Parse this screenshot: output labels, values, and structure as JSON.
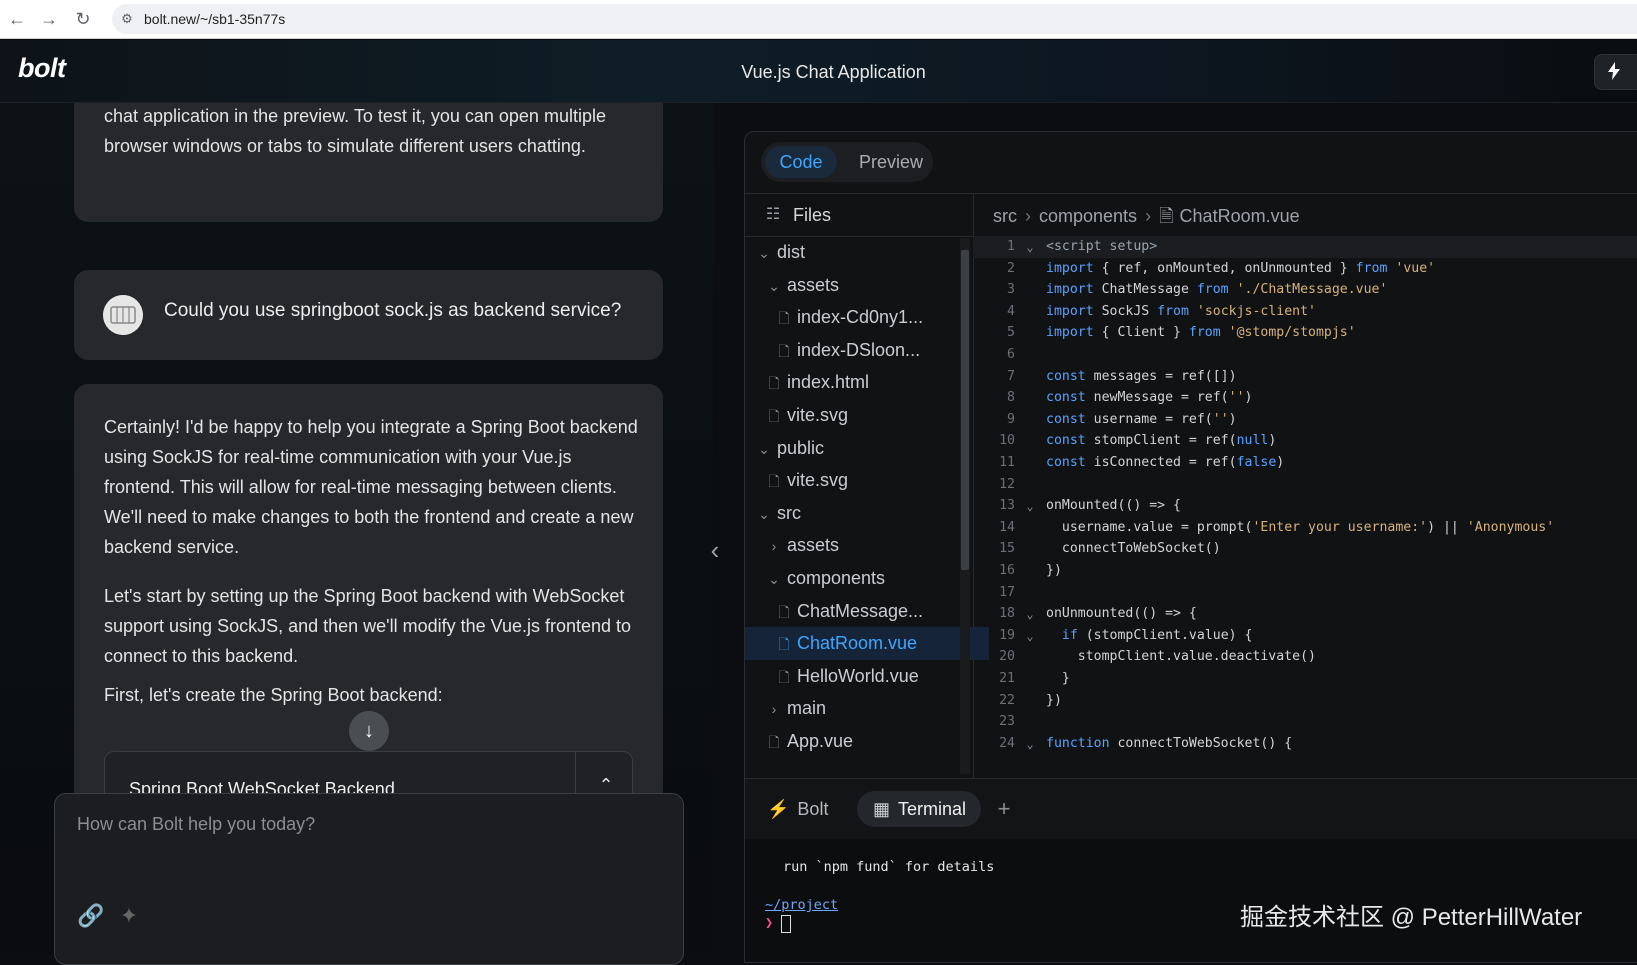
{
  "browser": {
    "url": "bolt.new/~/sb1-35n77s",
    "back_icon": "arrow-left-icon",
    "forward_icon": "arrow-right-icon",
    "reload_icon": "reload-icon",
    "site_info_icon": "tune-icon"
  },
  "header": {
    "logo": "bolt",
    "title": "Vue.js Chat Application"
  },
  "chat": {
    "messages": [
      {
        "role": "assistant",
        "text": "The development server is now running. You can interact with the chat application in the preview. To test it, you can open multiple browser windows or tabs to simulate different users chatting."
      },
      {
        "role": "user",
        "text": "Could you use springboot sock.js as backend service?"
      },
      {
        "role": "assistant",
        "paragraphs": [
          "Certainly! I'd be happy to help you integrate a Spring Boot backend using SockJS for real-time communication with your Vue.js frontend. This will allow for real-time messaging between clients. We'll need to make changes to both the frontend and create a new backend service.",
          "Let's start by setting up the Spring Boot backend with WebSocket support using SockJS, and then we'll modify the Vue.js frontend to connect to this backend.",
          "First, let's create the Spring Boot backend:"
        ],
        "artifact_title": "Spring Boot WebSocket Backend"
      }
    ],
    "prompt_placeholder": "How can Bolt help you today?",
    "prompt_value": ""
  },
  "workbench": {
    "view_tabs": [
      "Code",
      "Preview"
    ],
    "active_view": "Code",
    "files_label": "Files",
    "tree": [
      {
        "label": "dist",
        "type": "folder",
        "open": true,
        "depth": 0
      },
      {
        "label": "assets",
        "type": "folder",
        "open": true,
        "depth": 1
      },
      {
        "label": "index-Cd0ny1...",
        "type": "file",
        "depth": 2
      },
      {
        "label": "index-DSloon...",
        "type": "file",
        "depth": 2
      },
      {
        "label": "index.html",
        "type": "file",
        "depth": 1
      },
      {
        "label": "vite.svg",
        "type": "file",
        "depth": 1
      },
      {
        "label": "public",
        "type": "folder",
        "open": true,
        "depth": 0
      },
      {
        "label": "vite.svg",
        "type": "file",
        "depth": 1
      },
      {
        "label": "src",
        "type": "folder",
        "open": true,
        "depth": 0
      },
      {
        "label": "assets",
        "type": "folder",
        "open": false,
        "depth": 1
      },
      {
        "label": "components",
        "type": "folder",
        "open": true,
        "depth": 1
      },
      {
        "label": "ChatMessage...",
        "type": "file",
        "depth": 2
      },
      {
        "label": "ChatRoom.vue",
        "type": "file",
        "depth": 2,
        "selected": true
      },
      {
        "label": "HelloWorld.vue",
        "type": "file",
        "depth": 2
      },
      {
        "label": "main",
        "type": "folder",
        "open": false,
        "depth": 1
      },
      {
        "label": "App.vue",
        "type": "file",
        "depth": 1
      }
    ],
    "breadcrumb": [
      "src",
      "components",
      "ChatRoom.vue"
    ],
    "code_lines": [
      {
        "n": "1",
        "fold": true,
        "code": "<script setup>"
      },
      {
        "n": "2",
        "code": "import { ref, onMounted, onUnmounted } from 'vue'"
      },
      {
        "n": "3",
        "code": "import ChatMessage from './ChatMessage.vue'"
      },
      {
        "n": "4",
        "code": "import SockJS from 'sockjs-client'"
      },
      {
        "n": "5",
        "code": "import { Client } from '@stomp/stompjs'"
      },
      {
        "n": "6",
        "code": ""
      },
      {
        "n": "7",
        "code": "const messages = ref([])"
      },
      {
        "n": "8",
        "code": "const newMessage = ref('')"
      },
      {
        "n": "9",
        "code": "const username = ref('')"
      },
      {
        "n": "10",
        "code": "const stompClient = ref(null)"
      },
      {
        "n": "11",
        "code": "const isConnected = ref(false)"
      },
      {
        "n": "12",
        "code": ""
      },
      {
        "n": "13",
        "fold": true,
        "code": "onMounted(() => {"
      },
      {
        "n": "14",
        "code": "  username.value = prompt('Enter your username:') || 'Anonymous'"
      },
      {
        "n": "15",
        "code": "  connectToWebSocket()"
      },
      {
        "n": "16",
        "code": "})"
      },
      {
        "n": "17",
        "code": ""
      },
      {
        "n": "18",
        "fold": true,
        "code": "onUnmounted(() => {"
      },
      {
        "n": "19",
        "fold": true,
        "code": "  if (stompClient.value) {"
      },
      {
        "n": "20",
        "code": "    stompClient.value.deactivate()"
      },
      {
        "n": "21",
        "code": "  }"
      },
      {
        "n": "22",
        "code": "})"
      },
      {
        "n": "23",
        "code": ""
      },
      {
        "n": "24",
        "fold": true,
        "code": "function connectToWebSocket() {"
      }
    ],
    "terminal_tabs": [
      "Bolt",
      "Terminal"
    ],
    "active_terminal_tab": "Terminal",
    "terminal": {
      "line1": "run `npm fund` for details",
      "cwd": "~/project",
      "prompt_symbol": "❯"
    }
  },
  "watermark": "掘金技术社区 @ PetterHillWater",
  "colors": {
    "accent": "#3ea6ff",
    "background": "#0b0d10",
    "card": "#26282c",
    "terminal_prompt": "#ff4d8a"
  }
}
